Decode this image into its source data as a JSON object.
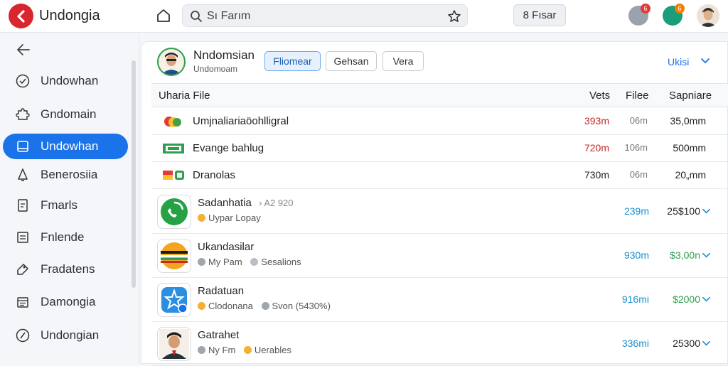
{
  "app": {
    "name": "Undongia"
  },
  "topbar": {
    "search_value": "Sı Farım",
    "button_label": "8 Fısar",
    "icon1_badge": "6",
    "icon2_badge": "6"
  },
  "sidebar": {
    "items": [
      {
        "label": "Undowhan",
        "icon": "check-circle-icon",
        "active": false
      },
      {
        "label": "Gndomain",
        "icon": "puzzle-icon",
        "active": false
      },
      {
        "label": "Undowhan",
        "icon": "folder-icon",
        "active": true
      },
      {
        "label": "Benerosiia",
        "icon": "bell-icon",
        "active": false
      },
      {
        "label": "Fmarls",
        "icon": "document-icon",
        "active": false
      },
      {
        "label": "Fnlende",
        "icon": "list-icon",
        "active": false
      },
      {
        "label": "Fradatens",
        "icon": "tag-icon",
        "active": false
      },
      {
        "label": "Damongia",
        "icon": "calendar-icon",
        "active": false
      },
      {
        "label": "Undongian",
        "icon": "compass-icon",
        "active": false
      }
    ]
  },
  "main": {
    "title": "Nndomsian",
    "subtitle": "Undomoam",
    "chips": [
      "Fliomear",
      "Gehsan",
      "Vera"
    ],
    "link": "Ukisi",
    "columns": [
      "Uharia File",
      "Vets",
      "Filee",
      "Sapniare"
    ],
    "rows": [
      {
        "name": "Umjnaliariaöohlligral",
        "v1": "393m",
        "v2": "06m",
        "v3": "35,0mm",
        "v1_color": "#c62828"
      },
      {
        "name": "Evange bahlug",
        "v1": "720m",
        "v2": "106m",
        "v3": "500mm",
        "v1_color": "#c62828"
      },
      {
        "name": "Dranolas",
        "v1": "730m",
        "v2": "06m",
        "v3": "20„mm",
        "v1_color": "#222222"
      }
    ],
    "cards": [
      {
        "title": "Sadanhatia",
        "meta": "A2 920",
        "sub1": "Uypar Lopay",
        "sub2": "",
        "v1": "239m",
        "v2": "25$100",
        "v2_color": "#222222"
      },
      {
        "title": "Ukandasilar",
        "meta": "",
        "sub1": "My Pam",
        "sub2": "Sesalions",
        "v1": "930m",
        "v2": "$3,00n",
        "v2_color": "#2e9e4f"
      },
      {
        "title": "Radatuan",
        "meta": "",
        "sub1": "Clodonana",
        "sub2": "Svon (5430%)",
        "v1": "916mi",
        "v2": "$2000",
        "v2_color": "#2e9e4f"
      },
      {
        "title": "Gatrahet",
        "meta": "",
        "sub1": "Ny Fm",
        "sub2": "Uerables",
        "v1": "336mi",
        "v2": "25300",
        "v2_color": "#222222"
      }
    ]
  },
  "colors": {
    "accent": "#1a73e8",
    "brand": "#d7262e",
    "positive": "#2e9e4f",
    "negative": "#c62828"
  }
}
